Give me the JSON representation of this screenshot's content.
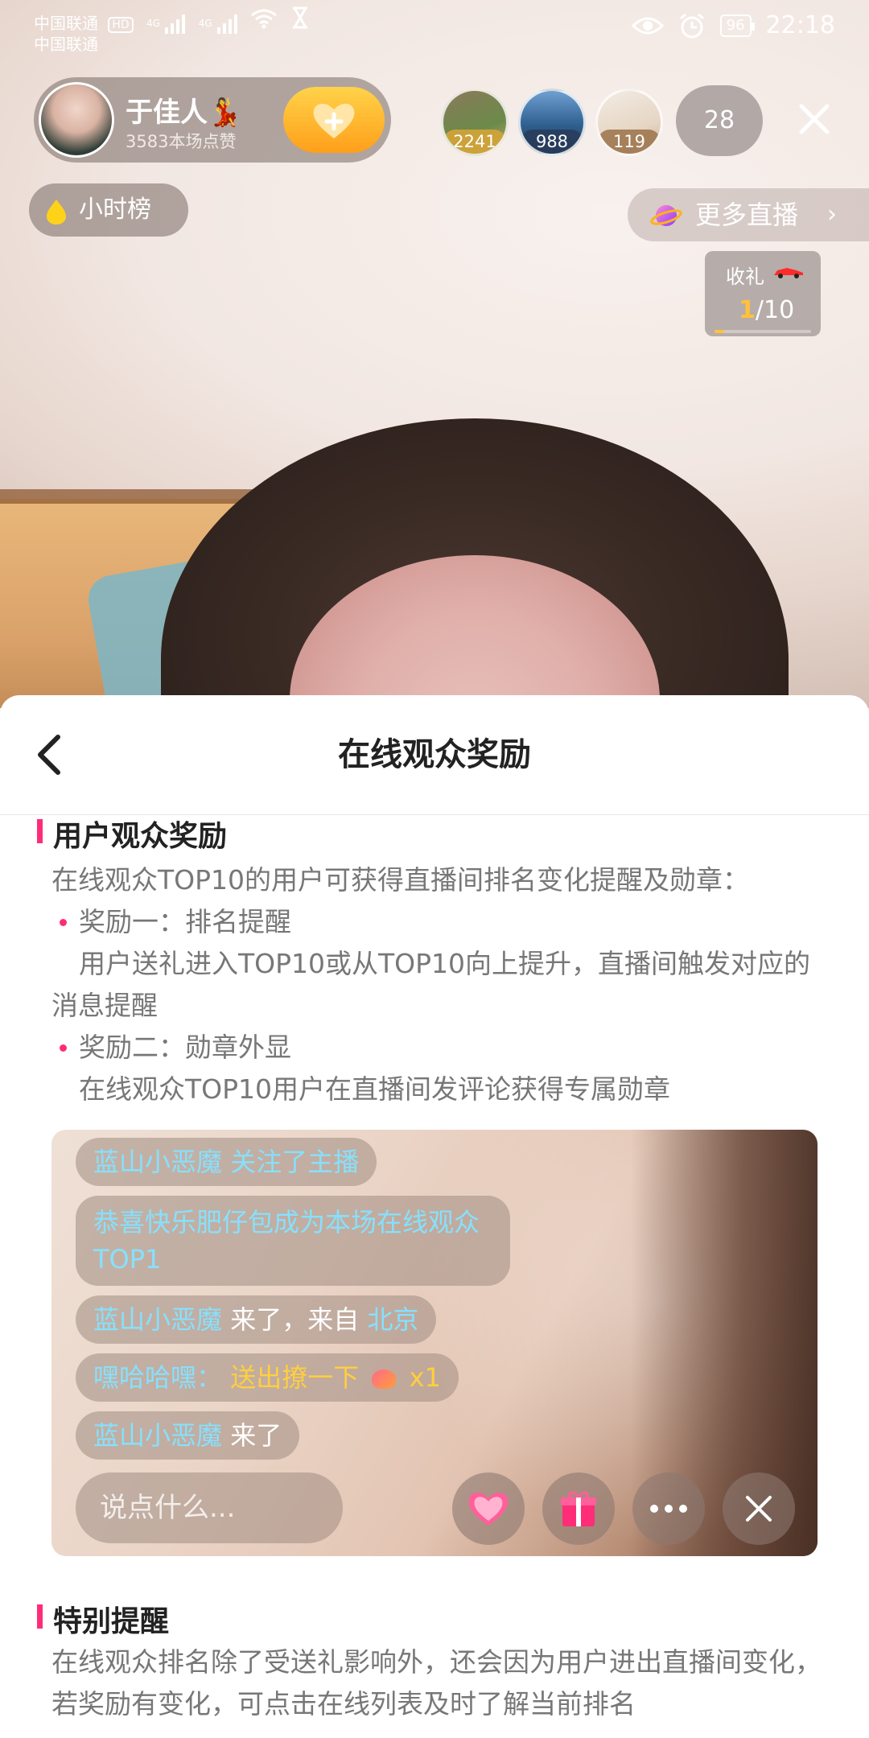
{
  "status_bar": {
    "carrier_1": "中国联通",
    "hd": "HD",
    "net_1": "4G",
    "net_2": "4G",
    "carrier_2": "中国联通",
    "battery": "96",
    "time": "22:18"
  },
  "host": {
    "name": "于佳人💃",
    "likes": "3583本场点赞",
    "follow_icon": "heart-plus-icon"
  },
  "viewers": {
    "items": [
      {
        "badge": "2241"
      },
      {
        "badge": "988"
      },
      {
        "badge": "119"
      }
    ],
    "count": "28"
  },
  "hourly_rank": {
    "label": "小时榜"
  },
  "more_live": {
    "label": "更多直播",
    "chevron": "›"
  },
  "gift_goal": {
    "label": "收礼",
    "current": "1",
    "total": "/10",
    "progress": 0.1
  },
  "sheet": {
    "title": "在线观众奖励",
    "section1_title": "用户观众奖励",
    "intro": "在线观众TOP10的用户可获得直播间排名变化提醒及勋章：",
    "reward1_title": "奖励一：排名提醒",
    "reward1_desc": "用户送礼进入TOP10或从TOP10向上提升，直播间触发对应的消息提醒",
    "reward2_title": "奖励二：勋章外显",
    "reward2_desc": "在线观众TOP10用户在直播间发评论获得专属勋章",
    "section2_title": "特别提醒",
    "note": "在线观众排名除了受送礼影响外，还会因为用户进出直播间变化，若奖励有变化，可点击在线列表及时了解当前排名"
  },
  "preview": {
    "msg1_user": "蓝山小恶魔",
    "msg1_text": " 关注了主播",
    "msg2_text": "恭喜快乐肥仔包成为本场在线观众TOP1",
    "msg3_user": "蓝山小恶魔",
    "msg3_text": " 来了，来自 ",
    "msg3_city": "北京",
    "msg4_user": "嘿哈哈嘿：",
    "msg4_gift": "送出撩一下",
    "msg4_count": "x1",
    "msg5_user": "蓝山小恶魔",
    "msg5_text": " 来了",
    "input_placeholder": "说点什么..."
  },
  "colors": {
    "accent": "#ff2d78",
    "user": "#86e1ff",
    "gift": "#ffcf3d"
  }
}
